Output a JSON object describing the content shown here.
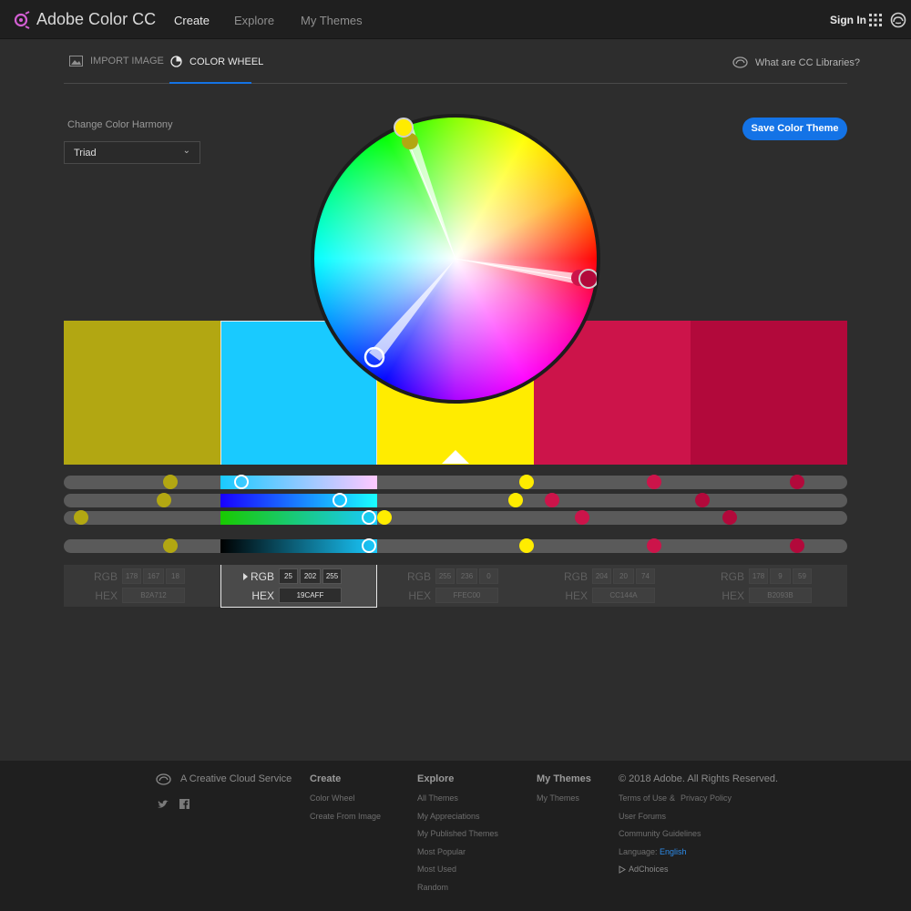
{
  "header": {
    "brand": "Adobe Color CC",
    "nav": [
      {
        "label": "Create"
      },
      {
        "label": "Explore"
      },
      {
        "label": "My Themes"
      }
    ],
    "signin": "Sign In"
  },
  "tabs": {
    "import": "IMPORT IMAGE",
    "wheel": "COLOR WHEEL",
    "cclib": "What are CC Libraries?"
  },
  "harmony": {
    "label": "Change Color Harmony",
    "value": "Triad"
  },
  "save_button": "Save Color Theme",
  "swatches": [
    {
      "hex": "#B2A712",
      "rgb": [
        "178",
        "167",
        "18"
      ],
      "hex_label": "B2A712"
    },
    {
      "hex": "#19CAFF",
      "rgb": [
        "25",
        "202",
        "255"
      ],
      "hex_label": "19CAFF"
    },
    {
      "hex": "#FFEC00",
      "rgb": [
        "255",
        "236",
        "0"
      ],
      "hex_label": "FFEC00"
    },
    {
      "hex": "#CC144A",
      "rgb": [
        "204",
        "20",
        "74"
      ],
      "hex_label": "CC144A"
    },
    {
      "hex": "#B2093B",
      "rgb": [
        "178",
        "9",
        "59"
      ],
      "hex_label": "B2093B"
    }
  ],
  "selected_swatch": 1,
  "labels": {
    "rgb": "RGB",
    "hex": "HEX"
  },
  "footer": {
    "cc_service": "A Creative Cloud Service",
    "create": {
      "title": "Create",
      "links": [
        "Color Wheel",
        "Create From Image"
      ]
    },
    "explore": {
      "title": "Explore",
      "links": [
        "All Themes",
        "My Appreciations",
        "My Published Themes",
        "Most Popular",
        "Most Used",
        "Random"
      ]
    },
    "mythemes": {
      "title": "My Themes",
      "links": [
        "My Themes"
      ]
    },
    "legal": {
      "copyright": "© 2018 Adobe. All Rights Reserved.",
      "terms": "Terms of Use",
      "amp": "&",
      "privacy": "Privacy Policy",
      "forums": "User Forums",
      "guidelines": "Community Guidelines",
      "language_label": "Language:",
      "language": "English",
      "adchoices": "AdChoices"
    }
  }
}
